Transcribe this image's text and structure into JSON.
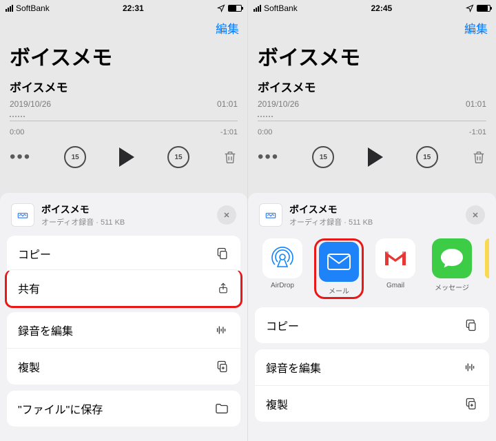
{
  "left": {
    "status": {
      "carrier": "SoftBank",
      "time": "22:31",
      "batteryPct": 60
    },
    "nav": {
      "edit": "編集"
    },
    "appTitle": "ボイスメモ",
    "memo": {
      "title": "ボイスメモ",
      "date": "2019/10/26",
      "duration": "01:01"
    },
    "timeline": {
      "start": "0:00",
      "end": "-1:01"
    },
    "skipSeconds": "15",
    "sheet": {
      "fileName": "ボイスメモ",
      "fileSub": "オーディオ録音 · 511 KB",
      "actions": {
        "copy": "コピー",
        "share": "共有",
        "editRecording": "録音を編集",
        "duplicate": "複製",
        "saveToFiles": "\"ファイル\"に保存"
      }
    }
  },
  "right": {
    "status": {
      "carrier": "SoftBank",
      "time": "22:45",
      "batteryPct": 85
    },
    "nav": {
      "edit": "編集"
    },
    "appTitle": "ボイスメモ",
    "memo": {
      "title": "ボイスメモ",
      "date": "2019/10/26",
      "duration": "01:01"
    },
    "timeline": {
      "start": "0:00",
      "end": "-1:01"
    },
    "skipSeconds": "15",
    "sheet": {
      "fileName": "ボイスメモ",
      "fileSub": "オーディオ録音 · 511 KB",
      "shareApps": {
        "airdrop": "AirDrop",
        "mail": "メール",
        "gmail": "Gmail",
        "messages": "メッセージ"
      },
      "actions": {
        "copy": "コピー",
        "editRecording": "録音を編集",
        "duplicate": "複製"
      }
    }
  }
}
